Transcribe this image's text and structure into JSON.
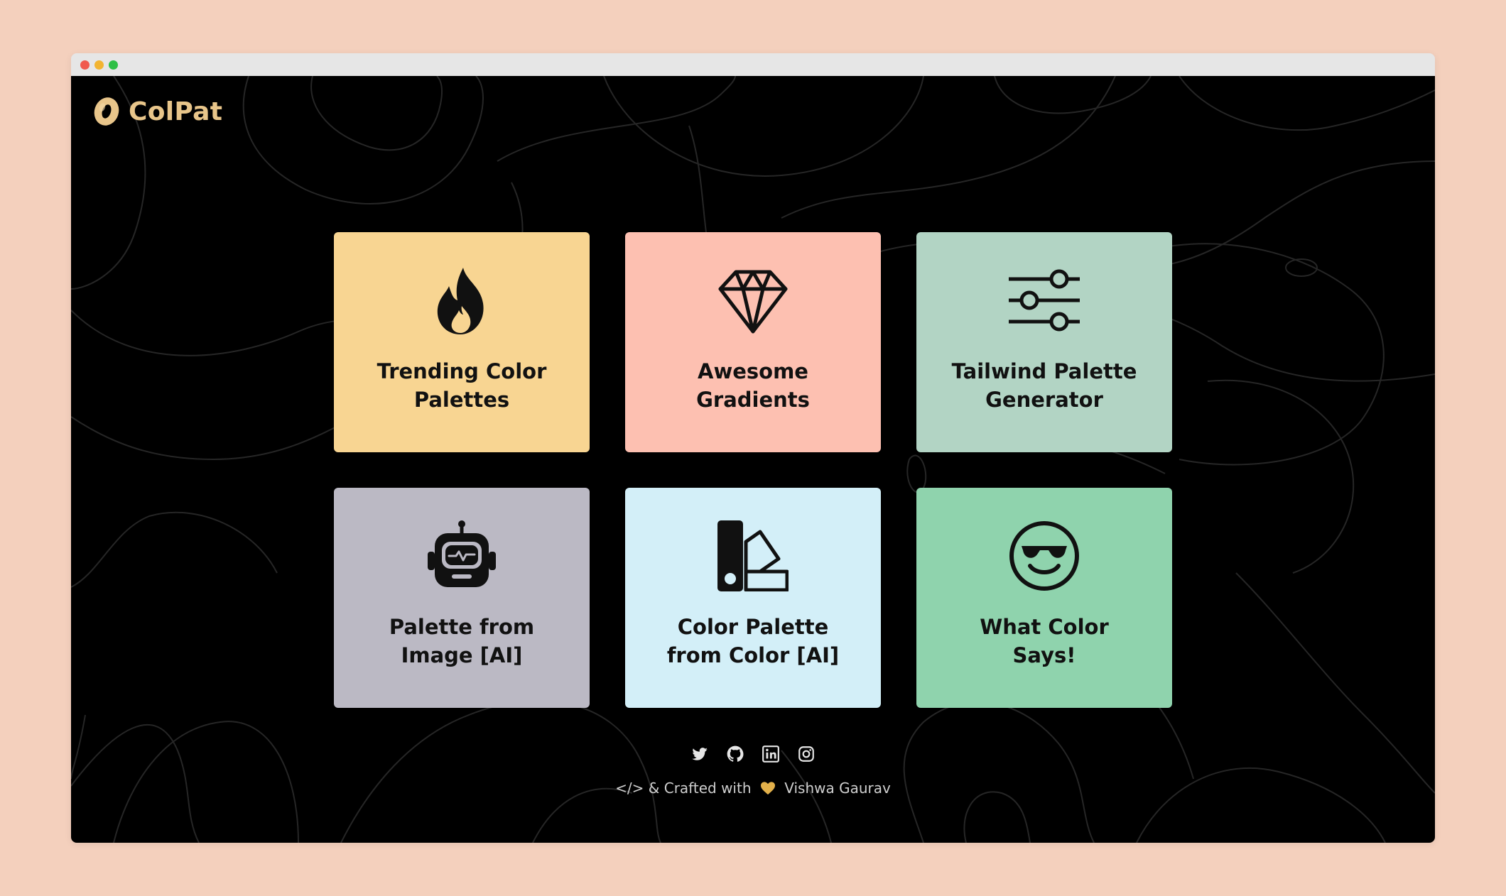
{
  "app": {
    "name": "ColPat",
    "logo_color": "#e8c58a"
  },
  "window": {
    "dots": [
      "#f05a4f",
      "#f2b431",
      "#2fbf46"
    ]
  },
  "cards": [
    {
      "label_line1": "Trending Color",
      "label_line2": "Palettes",
      "icon": "fire-icon",
      "color": "#f8d592"
    },
    {
      "label_line1": "Awesome",
      "label_line2": "Gradients",
      "icon": "diamond-icon",
      "color": "#fdc0b1"
    },
    {
      "label_line1": "Tailwind Palette",
      "label_line2": "Generator",
      "icon": "sliders-icon",
      "color": "#b2d4c4"
    },
    {
      "label_line1": "Palette from",
      "label_line2": "Image [AI]",
      "icon": "robot-icon",
      "color": "#bbb9c4"
    },
    {
      "label_line1": "Color Palette",
      "label_line2": "from Color [AI]",
      "icon": "swatch-icon",
      "color": "#d3eff8"
    },
    {
      "label_line1": "What Color",
      "label_line2": "Says!",
      "icon": "cool-face-icon",
      "color": "#8fd3ad"
    }
  ],
  "social": [
    "twitter-icon",
    "github-icon",
    "linkedin-icon",
    "instagram-icon"
  ],
  "footer": {
    "prefix": "</> & Crafted with",
    "author": "Vishwa Gaurav",
    "heart_color": "#e2b04a"
  }
}
